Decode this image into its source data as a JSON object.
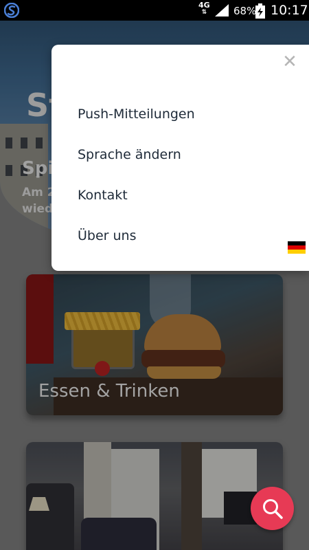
{
  "status_bar": {
    "network": "4G",
    "battery_percent": "68%",
    "time": "10:17"
  },
  "background": {
    "hero_title": "St",
    "hero_subtitle": "Spi",
    "hero_text_line1": "Am 2",
    "hero_text_line2": "wied",
    "cards": [
      {
        "label": "Essen & Trinken"
      },
      {
        "label": ""
      }
    ]
  },
  "menu": {
    "close_icon": "close-icon",
    "items": [
      {
        "label": "Push-Mitteilungen"
      },
      {
        "label": "Sprache ändern",
        "flag": "germany-flag-icon"
      },
      {
        "label": "Kontakt"
      },
      {
        "label": "Über uns"
      }
    ]
  },
  "fab": {
    "icon": "search-icon"
  },
  "colors": {
    "accent": "#e73a55",
    "menu_text": "#1e2a38",
    "close": "#b5b5b5"
  }
}
